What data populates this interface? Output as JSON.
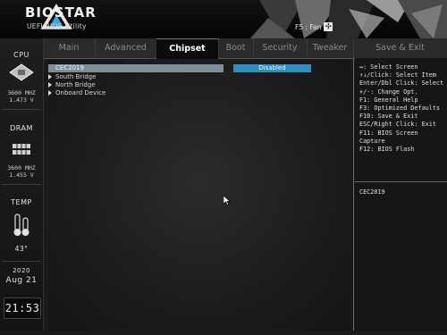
{
  "header": {
    "brand": "BIOSTAR",
    "tagline": "UEFI BIOS Utility",
    "fan_hint": "F5 : Fan"
  },
  "tabs": [
    {
      "label": "Main",
      "active": false
    },
    {
      "label": "Advanced",
      "active": false
    },
    {
      "label": "Chipset",
      "active": true
    },
    {
      "label": "Boot",
      "active": false
    },
    {
      "label": "Security",
      "active": false
    },
    {
      "label": "Tweaker",
      "active": false
    },
    {
      "label": "Save & Exit",
      "active": false
    }
  ],
  "sidebar": {
    "cpu": {
      "label": "CPU",
      "freq": "3600 MHZ",
      "volt": "1.473 V"
    },
    "dram": {
      "label": "DRAM",
      "freq": "3600 MHZ",
      "volt": "1.455 V"
    },
    "temp": {
      "label": "TEMP",
      "value": "43°"
    },
    "date": {
      "year": "2020",
      "day": "Aug 21"
    },
    "time": "21:53"
  },
  "menu": [
    {
      "label": "CEC2019",
      "value": "Disabled",
      "selected": true,
      "submenu": false
    },
    {
      "label": "South Bridge",
      "submenu": true
    },
    {
      "label": "North Bridge",
      "submenu": true
    },
    {
      "label": "Onboard Device",
      "submenu": true
    }
  ],
  "help": {
    "keys": "↔: Select Screen\n↑↓/Click: Select Item\nEnter/Dbl Click: Select\n+/-: Change Opt.\nF1: General Help\nF3: Optimized Defaults\nF10: Save & Exit\nESC/Right Click: Exit\nF11: BIOS Screen Capture\nF12: BIOS Flash",
    "description": "CEC2019"
  },
  "colors": {
    "accent": "#2e8fbf",
    "highlight": "#7d8e9b",
    "background": "#1a1a1a"
  }
}
